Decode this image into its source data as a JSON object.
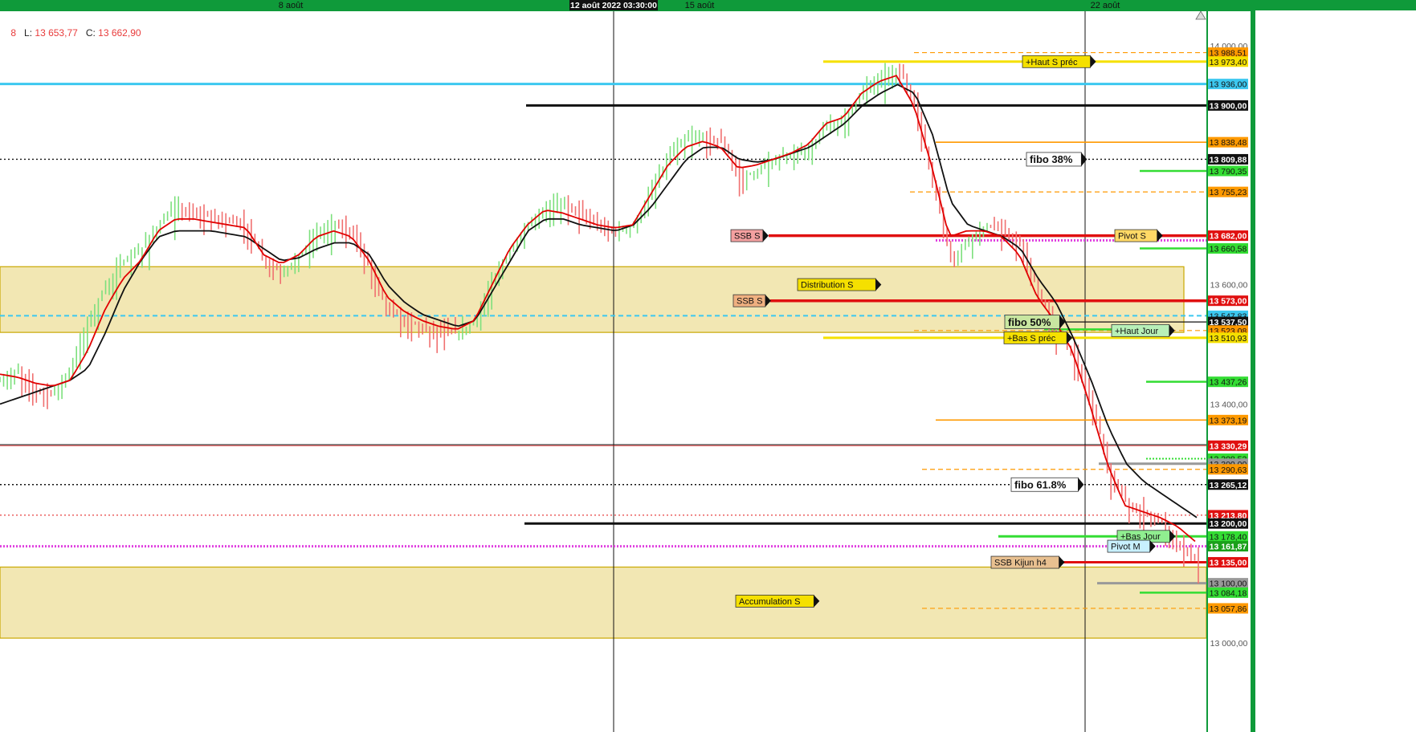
{
  "window": {
    "date_labels": [
      "8 août",
      "15 août",
      "22 août"
    ],
    "crosshair_label": "12 août 2022 03:30:00"
  },
  "ohlc": {
    "o_tail": "8",
    "l_label": "L:",
    "l_value": "13 653,77",
    "c_label": "C:",
    "c_value": "13 662,90"
  },
  "colors": {
    "frame": "#0f9a3a",
    "bull": "#7de07d",
    "bear": "#f07070",
    "ema_fast": "#e00000",
    "ema_slow": "#111111",
    "zone_fill": "#f2e7b3",
    "zone_border": "#c9a800",
    "orange": "#ff9900",
    "cyan": "#3cc8f0",
    "magenta": "#e040e0",
    "green": "#33dd33",
    "yellow": "#f5e000",
    "red": "#e01010"
  },
  "chart_data": {
    "type": "candlestick",
    "title": "",
    "xlabel": "",
    "ylabel": "",
    "x_dates": [
      "8 août",
      "15 août",
      "22 août"
    ],
    "ylim": [
      12990,
      14020
    ],
    "y_ticks": [
      14000,
      13600,
      13400,
      13000
    ],
    "y_tick_labels": [
      "14 000,00",
      "13 600,00",
      "13 400,00",
      "13 000,00"
    ],
    "close_path": [
      13440,
      13455,
      13425,
      13420,
      13460,
      13540,
      13600,
      13640,
      13660,
      13700,
      13730,
      13720,
      13715,
      13710,
      13700,
      13640,
      13620,
      13650,
      13690,
      13700,
      13690,
      13630,
      13560,
      13540,
      13530,
      13525,
      13520,
      13540,
      13610,
      13660,
      13700,
      13730,
      13740,
      13720,
      13700,
      13690,
      13700,
      13760,
      13820,
      13845,
      13850,
      13840,
      13780,
      13790,
      13810,
      13820,
      13830,
      13870,
      13880,
      13930,
      13950,
      13960,
      13900,
      13760,
      13640,
      13680,
      13700,
      13690,
      13660,
      13580,
      13520,
      13480,
      13400,
      13280,
      13230,
      13220,
      13200,
      13160,
      13140
    ],
    "ema_fast": [
      13450,
      13445,
      13435,
      13430,
      13440,
      13490,
      13560,
      13610,
      13640,
      13690,
      13710,
      13710,
      13705,
      13700,
      13695,
      13650,
      13635,
      13650,
      13680,
      13690,
      13680,
      13640,
      13580,
      13555,
      13540,
      13530,
      13525,
      13540,
      13600,
      13660,
      13700,
      13725,
      13720,
      13710,
      13700,
      13695,
      13700,
      13750,
      13800,
      13830,
      13840,
      13830,
      13795,
      13800,
      13810,
      13820,
      13835,
      13870,
      13880,
      13920,
      13940,
      13950,
      13900,
      13800,
      13680,
      13690,
      13690,
      13680,
      13650,
      13580,
      13540,
      13490,
      13400,
      13300,
      13230,
      13220,
      13210,
      13195,
      13170
    ],
    "ema_slow": [
      13400,
      13410,
      13420,
      13430,
      13440,
      13460,
      13520,
      13590,
      13640,
      13680,
      13690,
      13690,
      13690,
      13685,
      13680,
      13660,
      13640,
      13645,
      13660,
      13670,
      13670,
      13650,
      13600,
      13570,
      13550,
      13540,
      13530,
      13540,
      13590,
      13640,
      13690,
      13710,
      13710,
      13700,
      13695,
      13690,
      13700,
      13730,
      13770,
      13810,
      13830,
      13830,
      13810,
      13805,
      13810,
      13820,
      13830,
      13850,
      13870,
      13900,
      13920,
      13935,
      13920,
      13850,
      13740,
      13700,
      13690,
      13680,
      13660,
      13610,
      13570,
      13510,
      13440,
      13360,
      13300,
      13270,
      13250,
      13230,
      13210
    ],
    "zones": [
      {
        "label": "Distribution S",
        "from": 13520,
        "to": 13630
      },
      {
        "label": "Accumulation S",
        "from": 13008,
        "to": 13127
      }
    ],
    "levels": [
      {
        "value": 13988.51,
        "label": "13 988,51",
        "color": "#ff9900"
      },
      {
        "value": 13973.4,
        "label": "13 973,40",
        "color": "#f5e000"
      },
      {
        "value": 13936.0,
        "label": "13 936,00",
        "color": "#3cc8f0"
      },
      {
        "value": 13900.0,
        "label": "13 900,00",
        "color": "#111111"
      },
      {
        "value": 13838.48,
        "label": "13 838,48",
        "color": "#ff9900"
      },
      {
        "value": 13809.88,
        "label": "13 809,88",
        "color": "#111111"
      },
      {
        "value": 13790.35,
        "label": "13 790,35",
        "color": "#33dd33"
      },
      {
        "value": 13755.23,
        "label": "13 755,23",
        "color": "#ff9900"
      },
      {
        "value": 13682.0,
        "label": "13 682,00",
        "color": "#e01010"
      },
      {
        "value": 13660.58,
        "label": "13 660,58",
        "color": "#33dd33"
      },
      {
        "value": 13573.0,
        "label": "13 573,00",
        "color": "#e01010"
      },
      {
        "value": 13547.83,
        "label": "13 547,83",
        "color": "#3cc8f0"
      },
      {
        "value": 13537.5,
        "label": "13 537,50",
        "color": "#111111"
      },
      {
        "value": 13523.08,
        "label": "13 523,08",
        "color": "#ff9900"
      },
      {
        "value": 13510.93,
        "label": "13 510,93",
        "color": "#f5e000"
      },
      {
        "value": 13437.26,
        "label": "13 437,26",
        "color": "#33dd33"
      },
      {
        "value": 13373.19,
        "label": "13 373,19",
        "color": "#ff9900"
      },
      {
        "value": 13330.29,
        "label": "13 330,29",
        "color": "#e01010"
      },
      {
        "value": 13308.52,
        "label": "13 308,52",
        "color": "#33dd33"
      },
      {
        "value": 13300.0,
        "label": "13 300,00",
        "color": "#999999"
      },
      {
        "value": 13290.63,
        "label": "13 290,63",
        "color": "#ff9900"
      },
      {
        "value": 13265.12,
        "label": "13 265,12",
        "color": "#111111"
      },
      {
        "value": 13213.8,
        "label": "13 213,80",
        "color": "#e01010"
      },
      {
        "value": 13200.0,
        "label": "13 200,00",
        "color": "#111111"
      },
      {
        "value": 13178.4,
        "label": "13 178,40",
        "color": "#33dd33"
      },
      {
        "value": 13161.87,
        "label": "13 161,87",
        "color": "#e040e0"
      },
      {
        "value": 13135.0,
        "label": "13 135,00",
        "color": "#e01010"
      },
      {
        "value": 13100.0,
        "label": "13 100,00",
        "color": "#999999"
      },
      {
        "value": 13084.18,
        "label": "13 084,18",
        "color": "#33dd33"
      },
      {
        "value": 13057.86,
        "label": "13 057,86",
        "color": "#ff9900"
      }
    ],
    "annotations": [
      {
        "text": "+Haut S préc",
        "value": 13973.4
      },
      {
        "text": "fibo 38%",
        "value": 13809.88
      },
      {
        "text": "SSB S",
        "value": 13682.0
      },
      {
        "text": "Pivot S",
        "value": 13682.0
      },
      {
        "text": "Distribution S",
        "value": 13600
      },
      {
        "text": "SSB S",
        "value": 13573.0
      },
      {
        "text": "fibo 50%",
        "value": 13537.5
      },
      {
        "text": "+Haut Jour",
        "value": 13523.08
      },
      {
        "text": "+Bas S préc",
        "value": 13510.93
      },
      {
        "text": "fibo 61.8%",
        "value": 13265.12
      },
      {
        "text": "+Bas Jour",
        "value": 13178.4
      },
      {
        "text": "Pivot M",
        "value": 13161.87
      },
      {
        "text": "SSB Kijun h4",
        "value": 13135.0
      },
      {
        "text": "Accumulation S",
        "value": 13070
      }
    ],
    "grid": false,
    "legend": "none"
  }
}
